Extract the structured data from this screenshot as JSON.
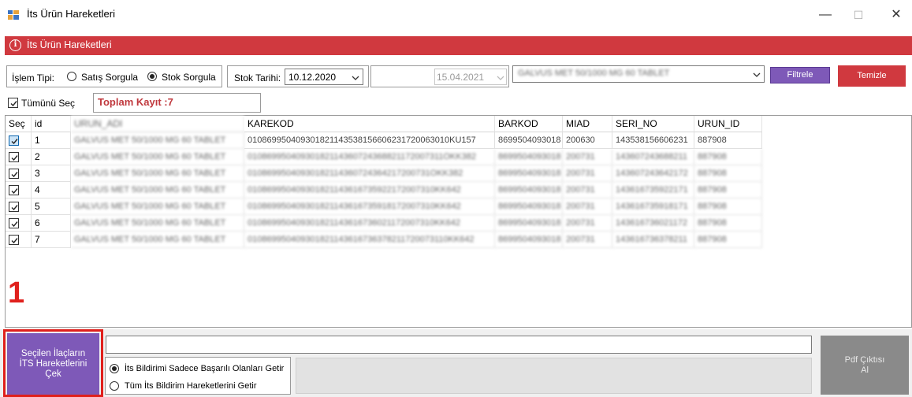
{
  "window": {
    "title": "İts Ürün Hareketleri",
    "controls": {
      "minimize": "—",
      "maximize": "☐",
      "close": "✕"
    }
  },
  "header": {
    "title": "İts Ürün Hareketleri",
    "info_icon": "info-circle-icon",
    "color": "#d0393f"
  },
  "filters": {
    "islem_tipi_label": "İşlem Tipi:",
    "radio_satis": "Satış Sorgula",
    "radio_stok": "Stok Sorgula",
    "selected": "Stok Sorgula",
    "stok_tarihi_label": "Stok Tarihi:",
    "stok_tarihi": "10.12.2020",
    "second_date": "15.04.2021",
    "product_select": "GALVUS MET 50/1000 MG 60 TABLET",
    "filtrele": "Filtrele",
    "temizle": "Temizle"
  },
  "select_all": {
    "label": "Tümünü Seç",
    "checked": true
  },
  "toplam_kayit": "Toplam Kayıt :7",
  "grid": {
    "columns": [
      "Seç",
      "id",
      "URUN_ADI",
      "KAREKOD",
      "BARKOD",
      "MIAD",
      "SERI_NO",
      "URUN_ID"
    ],
    "rows": [
      {
        "checked": true,
        "id": "1",
        "urun_adi": "GALVUS MET 50/1000 MG 60 TABLET",
        "karekod": "010869950409301821143538156606231720063010KU157",
        "barkod": "8699504093018",
        "miad": "200630",
        "seri_no": "143538156606231",
        "urun_id": "887908"
      },
      {
        "checked": true,
        "id": "2",
        "urun_adi": "GALVUS MET 50/1000 MG 60 TABLET",
        "karekod": "01086995040930182114360724368821172007311OKK382",
        "barkod": "8699504093018",
        "miad": "200731",
        "seri_no": "143607243688211",
        "urun_id": "887908"
      },
      {
        "checked": true,
        "id": "3",
        "urun_adi": "GALVUS MET 50/1000 MG 60 TABLET",
        "karekod": "01086995040930182114360724364217200731OKK382",
        "barkod": "8699504093018",
        "miad": "200731",
        "seri_no": "143607243642172",
        "urun_id": "887908"
      },
      {
        "checked": true,
        "id": "4",
        "urun_adi": "GALVUS MET 50/1000 MG 60 TABLET",
        "karekod": "010869950409301821143616735922172007310KK642",
        "barkod": "8699504093018",
        "miad": "200731",
        "seri_no": "143616735922171",
        "urun_id": "887908"
      },
      {
        "checked": true,
        "id": "5",
        "urun_adi": "GALVUS MET 50/1000 MG 60 TABLET",
        "karekod": "010869950409301821143616735918172007310KK642",
        "barkod": "8699504093018",
        "miad": "200731",
        "seri_no": "143616735918171",
        "urun_id": "887908"
      },
      {
        "checked": true,
        "id": "6",
        "urun_adi": "GALVUS MET 50/1000 MG 60 TABLET",
        "karekod": "010869950409301821143616736021172007310KK642",
        "barkod": "8699504093018",
        "miad": "200731",
        "seri_no": "143616736021172",
        "urun_id": "887908"
      },
      {
        "checked": true,
        "id": "7",
        "urun_adi": "GALVUS MET 50/1000 MG 60 TABLET",
        "karekod": "010869950409301821143616736378211720073110KK642",
        "barkod": "8699504093018",
        "miad": "200731",
        "seri_no": "143616736378211",
        "urun_id": "887908"
      }
    ]
  },
  "annotation_number": "1",
  "bottom": {
    "cek_button": "Seçilen İlaçların İTS Hareketlerini Çek",
    "radio_basarili": "İts Bildirimi Sadece Başarılı Olanları Getir",
    "radio_tum": "Tüm İts Bildirim Hareketlerini Getir",
    "selected": "İts Bildirimi Sadece Başarılı Olanları Getir",
    "pdf_button": "Pdf Çıktısı Al"
  },
  "colors": {
    "accent_red": "#d0393f",
    "button_purple": "#7e59b8",
    "highlight_red": "#e0201c",
    "pdf_disabled": "#8a8a8a"
  }
}
